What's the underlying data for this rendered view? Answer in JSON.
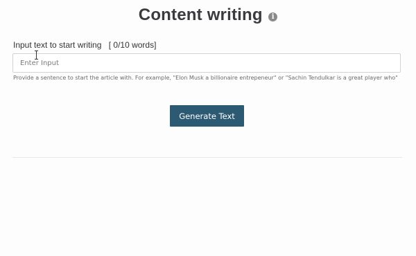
{
  "header": {
    "title": "Content writing",
    "info_icon": "info-icon",
    "info_glyph": "i"
  },
  "form": {
    "label": "Input text to start writing",
    "word_count": "[ 0/10 words]",
    "input_placeholder": "Enter Input",
    "input_value": "",
    "help_text": "Provide a sentence to start the article with. For example, \"Elon Musk a billionaire entrepeneur\" or \"Sachin Tendulkar is a great player who\"",
    "generate_label": "Generate Text"
  },
  "colors": {
    "button_bg": "#2d5a73",
    "button_text": "#ffffff",
    "title_text": "#3b3b3f",
    "divider": "#e6e8ea"
  },
  "cursor": {
    "icon": "text-cursor-icon"
  }
}
